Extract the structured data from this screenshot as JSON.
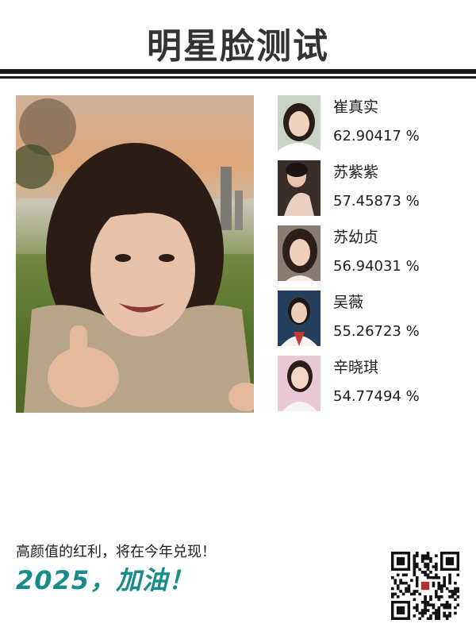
{
  "header": {
    "title": "明星脸测试"
  },
  "main_photo": {
    "icon": "user-photo"
  },
  "matches": [
    {
      "name": "崔真实",
      "score": "62.90417 %",
      "icon": "celebrity-photo"
    },
    {
      "name": "苏紫紫",
      "score": "57.45873 %",
      "icon": "celebrity-photo"
    },
    {
      "name": "苏幼贞",
      "score": "56.94031 %",
      "icon": "celebrity-photo"
    },
    {
      "name": "吴薇",
      "score": "55.26723 %",
      "icon": "celebrity-photo"
    },
    {
      "name": "辛晓琪",
      "score": "54.77494 %",
      "icon": "celebrity-photo"
    }
  ],
  "footer": {
    "line": "高颜值的红利，将在今年兑现！",
    "slogan": "2025，加油！"
  },
  "qr_code": {
    "icon": "qr-code"
  },
  "colors": {
    "accent": "#178c8a",
    "text": "#1e1e1e",
    "rule": "#1a1a1a"
  }
}
